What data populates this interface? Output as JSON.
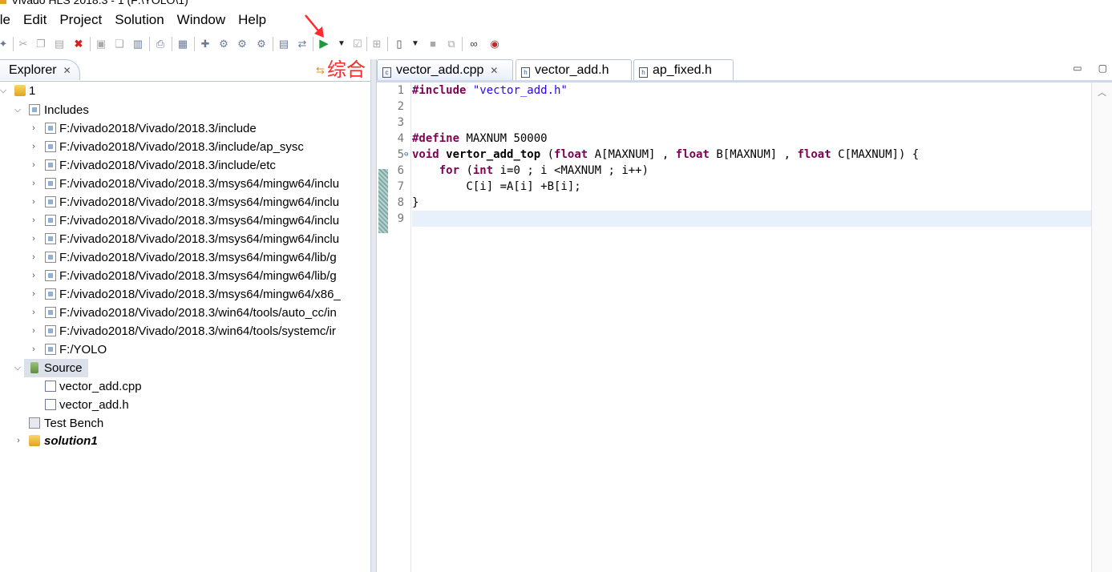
{
  "window": {
    "title": "Vivado HLS 2018.3 - 1 (F:\\YOLO\\1)"
  },
  "menu": [
    "ile",
    "Edit",
    "Project",
    "Solution",
    "Window",
    "Help"
  ],
  "annotation": {
    "label": "综合"
  },
  "explorer": {
    "tab_label": "Explorer",
    "tree": {
      "root": "1",
      "includes_label": "Includes",
      "includes": [
        "F:/vivado2018/Vivado/2018.3/include",
        "F:/vivado2018/Vivado/2018.3/include/ap_sysc",
        "F:/vivado2018/Vivado/2018.3/include/etc",
        "F:/vivado2018/Vivado/2018.3/msys64/mingw64/inclu",
        "F:/vivado2018/Vivado/2018.3/msys64/mingw64/inclu",
        "F:/vivado2018/Vivado/2018.3/msys64/mingw64/inclu",
        "F:/vivado2018/Vivado/2018.3/msys64/mingw64/inclu",
        "F:/vivado2018/Vivado/2018.3/msys64/mingw64/lib/g",
        "F:/vivado2018/Vivado/2018.3/msys64/mingw64/lib/g",
        "F:/vivado2018/Vivado/2018.3/msys64/mingw64/x86_",
        "F:/vivado2018/Vivado/2018.3/win64/tools/auto_cc/in",
        "F:/vivado2018/Vivado/2018.3/win64/tools/systemc/ir",
        "F:/YOLO"
      ],
      "source_label": "Source",
      "source_files": [
        "vector_add.cpp",
        "vector_add.h"
      ],
      "testbench_label": "Test Bench",
      "solution_label": "solution1"
    }
  },
  "editor": {
    "tabs": [
      {
        "label": "vector_add.cpp",
        "active": true
      },
      {
        "label": "vector_add.h",
        "active": false
      },
      {
        "label": "ap_fixed.h",
        "active": false
      }
    ],
    "line_numbers": [
      "1",
      "2",
      "3",
      "4",
      "5",
      "6",
      "7",
      "8",
      "9"
    ],
    "code": {
      "l1_kw": "#include",
      "l1_str": "\"vector_add.h\"",
      "l4_kw": "#define",
      "l4_rest": " MAXNUM 50000",
      "l5_void": "void",
      "l5_fn": "vertor_add_top",
      "l5_p1": " (",
      "l5_f1": "float",
      "l5_p2": " A[MAXNUM] , ",
      "l5_f2": "float",
      "l5_p3": " B[MAXNUM] , ",
      "l5_f3": "float",
      "l5_p4": " C[MAXNUM]) {",
      "l6_for": "for",
      "l6_p1": " (",
      "l6_int": "int",
      "l6_p2": " i=0 ; i <MAXNUM ; i++)",
      "l7": "        C[i] =A[i] +B[i];",
      "l8": "}"
    }
  },
  "colors": {
    "keyword": "#7f0055",
    "string": "#2a00ff",
    "annotation": "#ff2a2a"
  }
}
